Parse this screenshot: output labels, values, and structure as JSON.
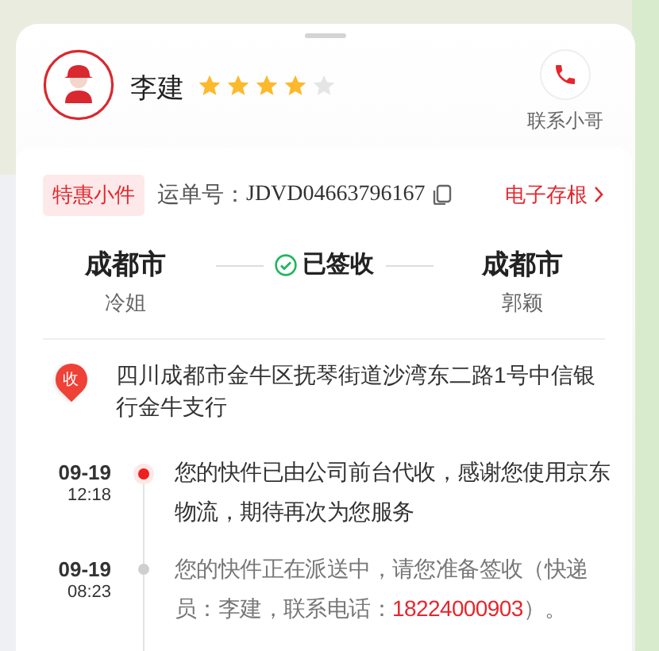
{
  "courier": {
    "name": "李建",
    "stars": 4,
    "call_label": "联系小哥"
  },
  "waybill": {
    "tag": "特惠小件",
    "label": "运单号：",
    "number": "JDVD04663796167",
    "link": "电子存根"
  },
  "route": {
    "from_city": "成都市",
    "from_name": "冷姐",
    "status": "已签收",
    "to_city": "成都市",
    "to_name": "郭颖"
  },
  "address": {
    "pin": "收",
    "text": "四川成都市金牛区抚琴街道沙湾东二路1号中信银行金牛支行"
  },
  "events": [
    {
      "date": "09-19",
      "time": "12:18",
      "current": true,
      "text": "您的快件已由公司前台代收，感谢您使用京东物流，期待再次为您服务"
    },
    {
      "date": "09-19",
      "time": "08:23",
      "current": false,
      "text": "您的快件正在派送中，请您准备签收（快递员：李建，联系电话：",
      "phone": "18224000903",
      "text_after": "）。"
    }
  ]
}
